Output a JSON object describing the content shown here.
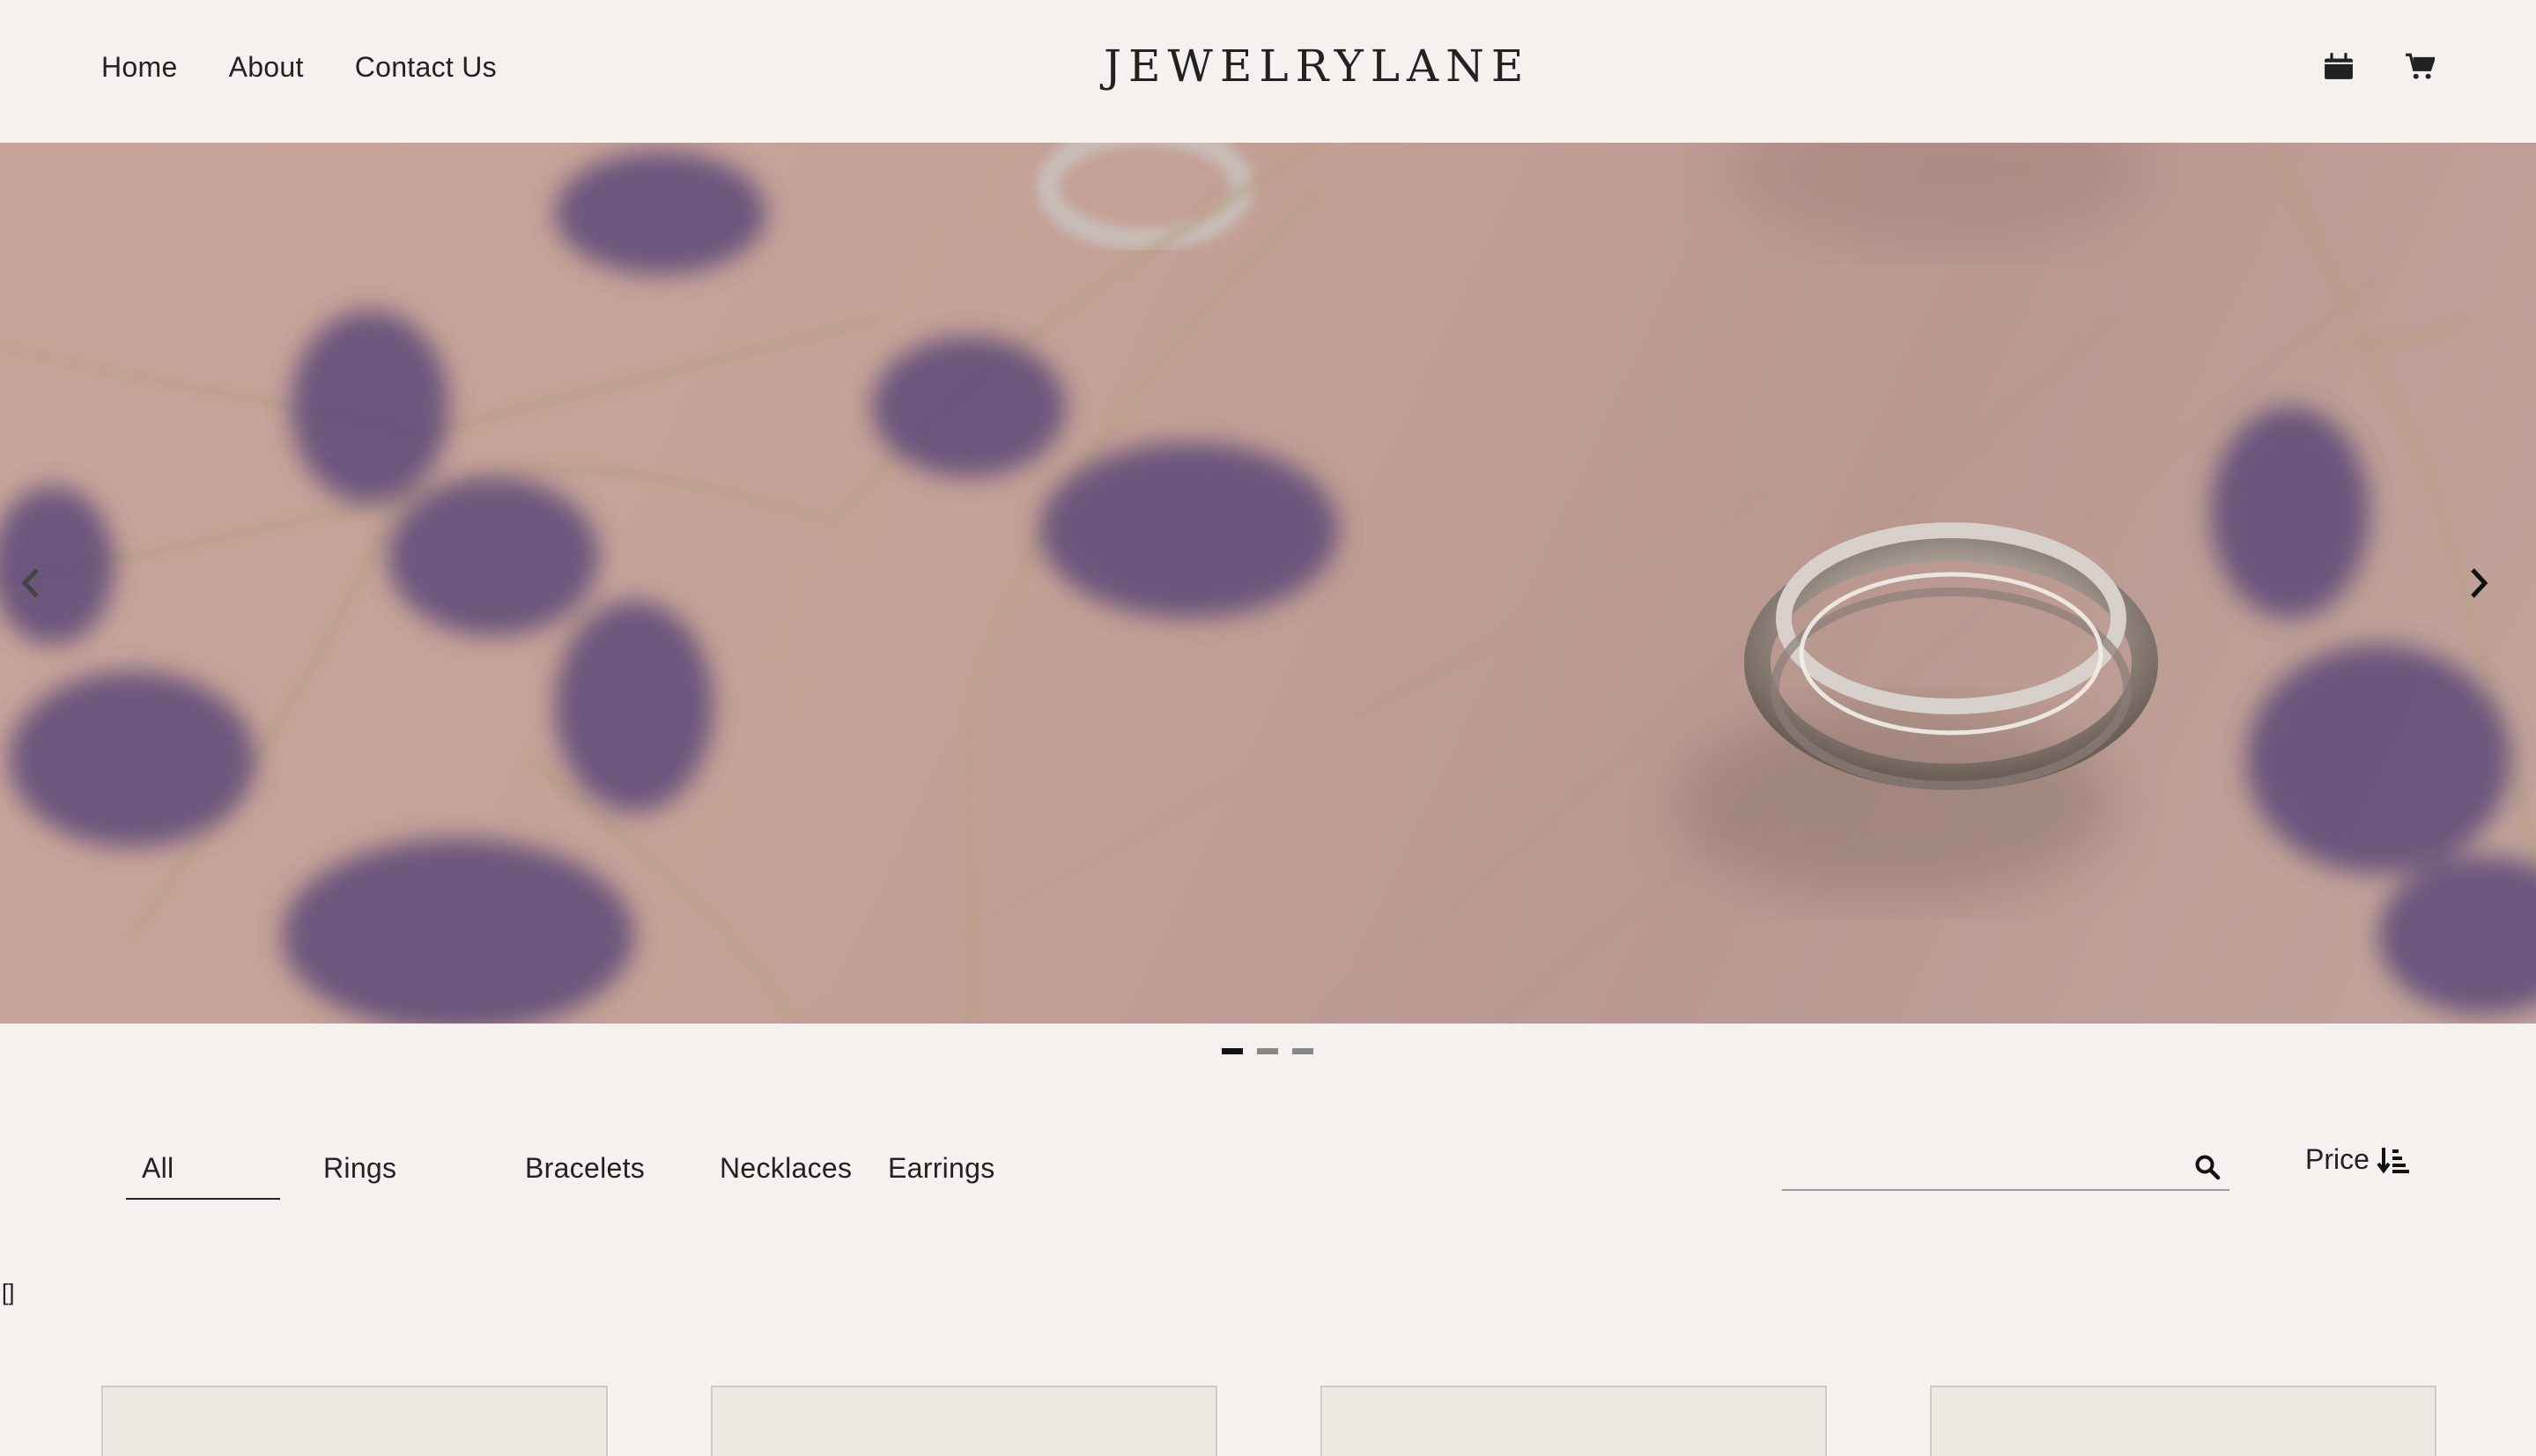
{
  "nav": {
    "home": "Home",
    "about": "About",
    "contact": "Contact Us"
  },
  "brand": {
    "logo": "JEWELRYLANE"
  },
  "header_icons": [
    "calendar-icon",
    "cart-icon"
  ],
  "hero": {
    "slides": 3,
    "active_slide": 1,
    "image_subject": "silver rings with dried purple flowers on pink background"
  },
  "filters": {
    "tabs": [
      "All",
      "Rings",
      "Bracelets",
      "Necklaces",
      "Earrings"
    ],
    "active": "All"
  },
  "search": {
    "placeholder": "",
    "value": ""
  },
  "sort": {
    "label": "Price",
    "icon": "sort-descending-icon"
  },
  "results_text": "[]",
  "colors": {
    "background": "#f5f1ee",
    "hero": "#c4a196",
    "card": "#ece9e3",
    "text": "#222222"
  }
}
